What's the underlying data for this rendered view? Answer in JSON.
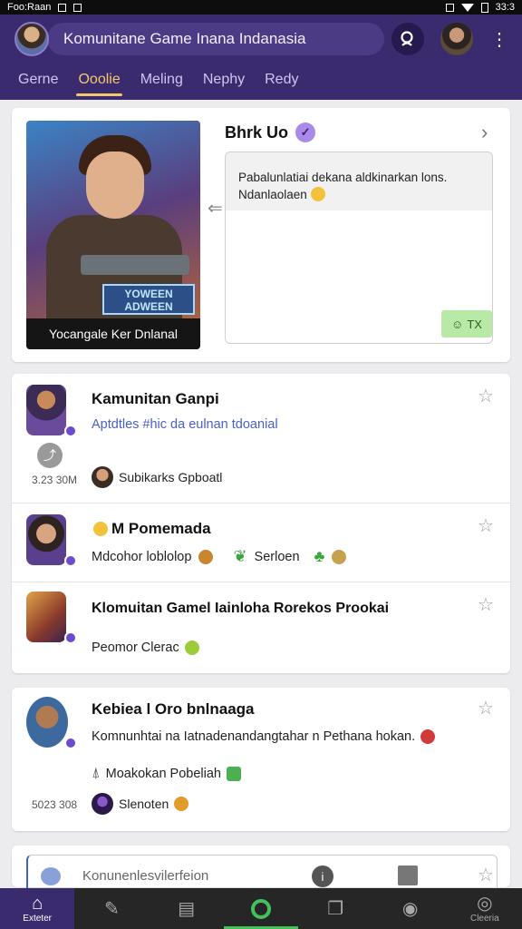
{
  "statusbar": {
    "left": "Foo:Raan",
    "right": "33:3"
  },
  "header": {
    "title": "Komunitane Game Inana Indanasia",
    "tabs": [
      {
        "label": "Gerne",
        "active": false
      },
      {
        "label": "Ooolie",
        "active": true
      },
      {
        "label": "Meling",
        "active": false
      },
      {
        "label": "Nephy",
        "active": false
      },
      {
        "label": "Redy",
        "active": false
      }
    ]
  },
  "featured": {
    "title": "Bhrk Uo",
    "poster_logo": "YOWEEN ADWEEN",
    "poster_caption": "Yocangale Ker Dnlanal",
    "message": "Pabalunlatiai dekana aldkinarkan lons. Ndanlaolaen",
    "badge": "TX"
  },
  "list": [
    {
      "title": "Kamunitan Ganpi",
      "subtitle": "Aptdtles #hic da eulnan tdoanial",
      "date": "3.23 30M",
      "author": "Subikarks Gpboatl"
    },
    {
      "title": "M Pomemada",
      "subtitle": "Mdcohor loblolop",
      "extra": "Serloen"
    },
    {
      "title": "Klomuitan Gamel Iainloha Rorekos Prookai",
      "subtitle": "Peomor Clerac"
    }
  ],
  "post": {
    "title": "Kebiea l Oro bnlnaaga",
    "body": "Komnunhtai na Iatnadenandangtahar n Pethana hokan.",
    "tag": "Moakokan Pobeliah",
    "date": "5023 308",
    "author": "Slenoten"
  },
  "composer": {
    "placeholder": "Konunenlesvilerfeion"
  },
  "bottomnav": [
    {
      "label": "Exteter",
      "icon": "home-icon"
    },
    {
      "label": "",
      "icon": "pencil-icon"
    },
    {
      "label": "",
      "icon": "document-icon"
    },
    {
      "label": "",
      "icon": "ring-icon"
    },
    {
      "label": "",
      "icon": "stack-icon"
    },
    {
      "label": "",
      "icon": "profile-icon"
    },
    {
      "label": "Cleeria",
      "icon": "settings-icon"
    }
  ],
  "colors": {
    "header": "#3a2a6e",
    "tab_active": "#f3c86b",
    "nav_active": "#42c15a"
  }
}
